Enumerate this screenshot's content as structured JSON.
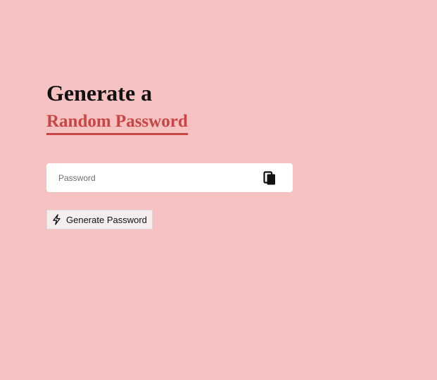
{
  "heading": {
    "line1": "Generate a",
    "line2": "Random Password"
  },
  "password_field": {
    "placeholder": "Password",
    "value": ""
  },
  "copy_button": {
    "icon": "copy-icon"
  },
  "generate_button": {
    "icon": "lightning-bolt-icon",
    "label": "Generate Password"
  },
  "colors": {
    "background": "#f5c1c1",
    "accent": "#c94545",
    "field_background": "#ffffff",
    "text": "#111111"
  }
}
